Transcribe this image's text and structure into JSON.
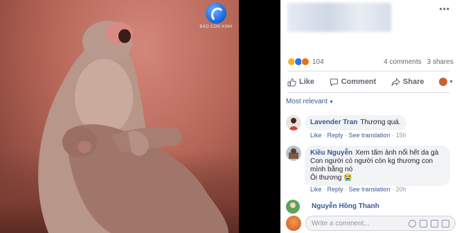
{
  "photo": {
    "watermark": "BÁO CON XINH",
    "description_icon": "monkey-photo"
  },
  "post": {
    "more_icon": "more-dots-icon",
    "more_label": "•••"
  },
  "reactions": {
    "icons": [
      "sad-reaction-icon",
      "like-reaction-icon",
      "angry-reaction-icon"
    ],
    "count": "104",
    "comments": "4 comments",
    "shares": "3 shares"
  },
  "actions": {
    "like": "Like",
    "comment": "Comment",
    "share": "Share"
  },
  "sort_label": "Most relevant",
  "comments": [
    {
      "name": "Lavender Tran",
      "text": "Thương quá.",
      "like": "Like",
      "reply": "Reply",
      "see_translation": "See translation",
      "time": "15h"
    },
    {
      "name": "Kiều Nguyễn",
      "text_line1": "Xem tấm ảnh nổi hết da gà",
      "text_line2": "Con người có người còn kg thương con",
      "text_line3": "mình bằng nó",
      "text_line4": "Ôi thương 😭",
      "like": "Like",
      "reply": "Reply",
      "see_translation": "See translation",
      "time": "20h"
    },
    {
      "name": "Nguyễn Hồng Thanh"
    }
  ],
  "write": {
    "placeholder": "Write a comment..."
  },
  "colors": {
    "link": "#385898",
    "meta": "#90949c",
    "like_blue": "#2078f4"
  }
}
